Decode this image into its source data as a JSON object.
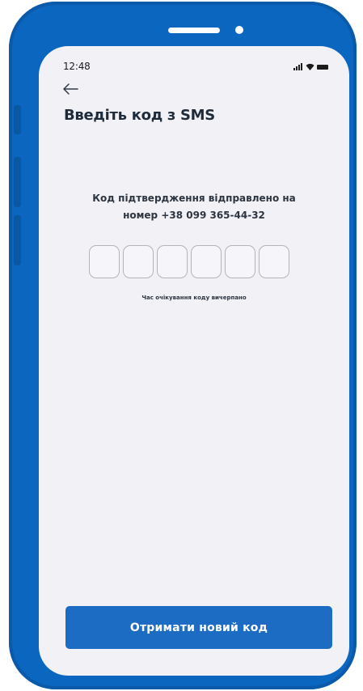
{
  "status_bar": {
    "time": "12:48"
  },
  "header": {
    "title": "Введіть код з SMS"
  },
  "body": {
    "message_line1": "Код підтвердження відправлено на",
    "message_line2": "номер  +38 099 365-44-32",
    "code_length": 6,
    "timeout_text": "Час очікування коду вичерпано"
  },
  "actions": {
    "resend_label": "Отримати новий код"
  },
  "colors": {
    "frame": "#0b66c0",
    "screen": "#f2f1f6",
    "accent": "#1b6cc2"
  },
  "icons": [
    "back-arrow-icon",
    "signal-icon",
    "wifi-icon",
    "battery-icon"
  ]
}
